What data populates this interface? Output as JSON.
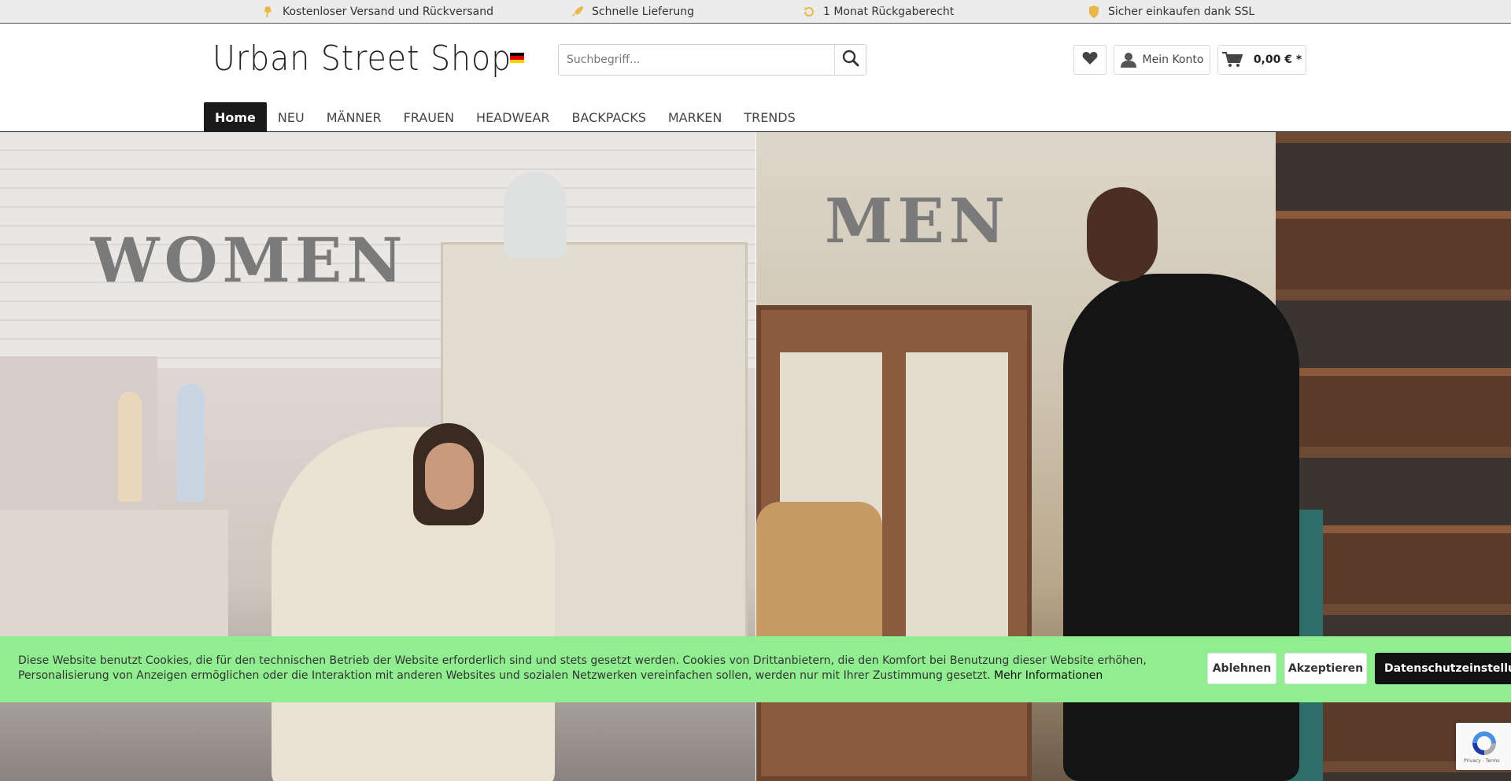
{
  "topbar": {
    "items": [
      {
        "icon": "shipping-icon",
        "label": "Kostenloser Versand und Rückversand"
      },
      {
        "icon": "rocket-icon",
        "label": "Schnelle Lieferung"
      },
      {
        "icon": "return-icon",
        "label": "1 Monat Rückgaberecht"
      },
      {
        "icon": "shield-icon",
        "label": "Sicher einkaufen dank SSL"
      }
    ],
    "accent": "#e8b84a"
  },
  "header": {
    "logo": "Urban Street Shop",
    "language_flag": "german-flag-icon",
    "search_placeholder": "Suchbegriff...",
    "wishlist_icon": "heart-icon",
    "account_label": "Mein Konto",
    "cart_total": "0,00 € *"
  },
  "nav": {
    "items": [
      "Home",
      "NEU",
      "MÄNNER",
      "FRAUEN",
      "HEADWEAR",
      "BACKPACKS",
      "MARKEN",
      "TRENDS"
    ],
    "active": "Home"
  },
  "banners": {
    "women_title": "WOMEN",
    "men_title": "MEN"
  },
  "cookie": {
    "text": "Diese Website benutzt Cookies, die für den technischen Betrieb der Website erforderlich sind und stets gesetzt werden. Cookies von Drittanbietern, die den Komfort bei Benutzung dieser Website erhöhen, Personalisierung von Anzeigen ermöglichen oder die Interaktion mit anderen Websites und sozialen Netzwerken vereinfachen sollen, werden nur mit Ihrer Zustimmung gesetzt.",
    "more_link": "Mehr Informationen",
    "decline": "Ablehnen",
    "accept": "Akzeptieren",
    "settings": "Datenschutzeinstellungen",
    "background": "#90ee90"
  },
  "recaptcha": {
    "footer": "Privacy - Terms"
  }
}
